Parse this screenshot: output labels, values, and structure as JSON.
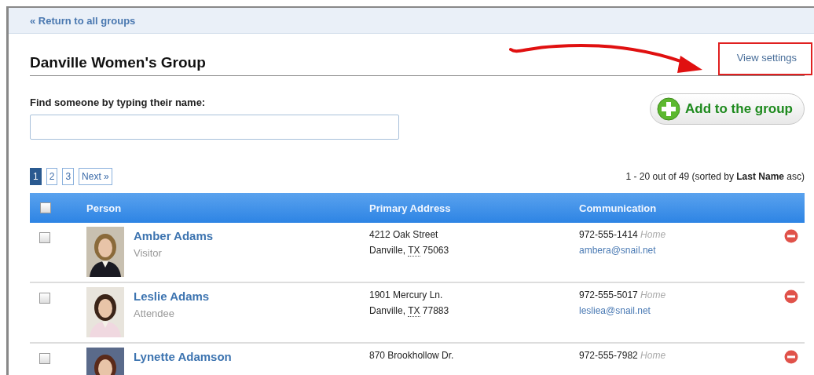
{
  "back_link": "« Return to all groups",
  "title": "Danville Women's Group",
  "settings_link": "View settings",
  "search": {
    "label": "Find someone by typing their name:"
  },
  "add_button": "Add to the group",
  "pagination": [
    {
      "label": "1",
      "selected": true
    },
    {
      "label": "2",
      "selected": false
    },
    {
      "label": "3",
      "selected": false
    },
    {
      "label": "Next »",
      "selected": false
    }
  ],
  "summary": "1 - 20 out of 49 (sorted by **Last Name** asc)",
  "table": {
    "select_all_checked": false,
    "columns": [
      "Person",
      "Primary Address",
      "Communication"
    ],
    "rows": [
      {
        "checked": false,
        "name": "Amber Adams",
        "role": "Visitor",
        "street": "4212 Oak Street",
        "city": "Danville,",
        "state": "TX",
        "zip": "75063",
        "phone": "972-555-1414",
        "phone_type": "Home",
        "email": "ambera@snail.net"
      },
      {
        "checked": false,
        "name": "Leslie Adams",
        "role": "Attendee",
        "street": "1901 Mercury Ln.",
        "city": "Danville,",
        "state": "TX",
        "zip": "77883",
        "phone": "972-555-5017",
        "phone_type": "Home",
        "email": "lesliea@snail.net"
      },
      {
        "checked": false,
        "name": "Lynette Adamson",
        "street": "870 Brookhollow Dr.",
        "phone": "972-555-7982",
        "phone_type": "Home"
      }
    ]
  }
}
